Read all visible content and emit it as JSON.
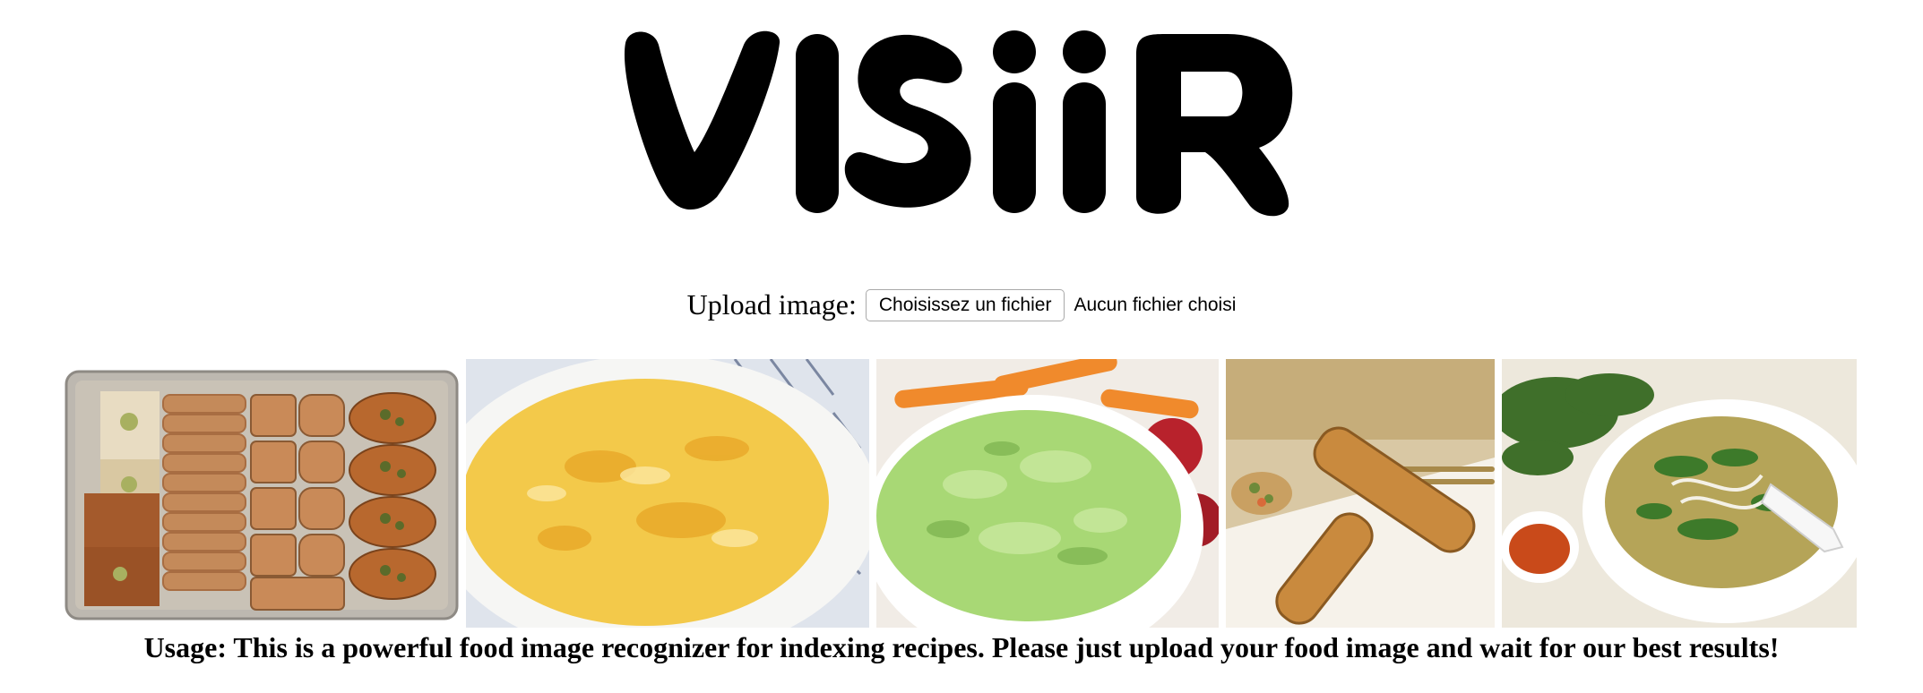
{
  "brand": {
    "logo_text": "VISiiR"
  },
  "upload": {
    "label": "Upload image:",
    "button_label": "Choisissez un fichier",
    "status": "Aucun fichier choisi"
  },
  "gallery": {
    "items": [
      {
        "name": "baklava tray"
      },
      {
        "name": "omelette"
      },
      {
        "name": "green dip"
      },
      {
        "name": "spring rolls"
      },
      {
        "name": "pho soup"
      }
    ]
  },
  "usage_text": "Usage: This is a powerful food image recognizer for indexing recipes. Please just upload your food image and wait for our best results!"
}
